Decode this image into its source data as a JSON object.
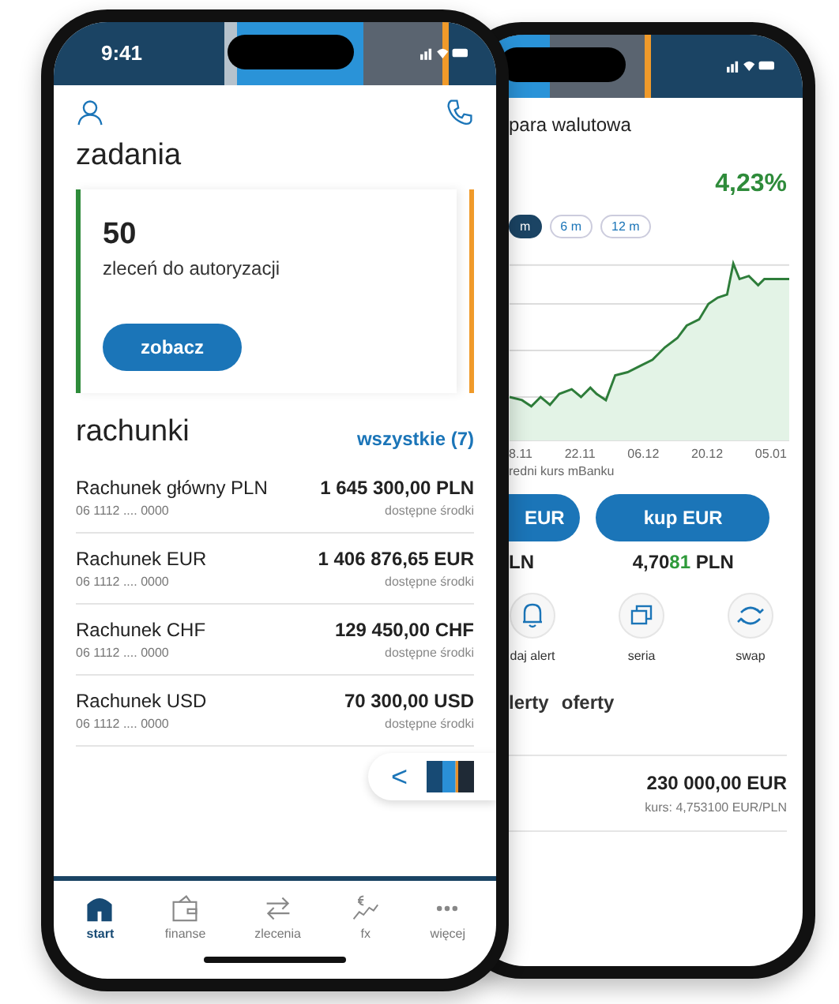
{
  "front_phone": {
    "status_time": "9:41",
    "tasks": {
      "title": "zadania",
      "count": "50",
      "label": "zleceń do autoryzacji",
      "button": "zobacz"
    },
    "accounts": {
      "title": "rachunki",
      "all_link": "wszystkie (7)",
      "rows": [
        {
          "name": "Rachunek główny PLN",
          "number": "06 1112 .... 0000",
          "amount": "1 645 300,00 PLN",
          "caption": "dostępne środki"
        },
        {
          "name": "Rachunek EUR",
          "number": "06 1112 .... 0000",
          "amount": "1 406 876,65 EUR",
          "caption": "dostępne środki"
        },
        {
          "name": "Rachunek CHF",
          "number": "06 1112 .... 0000",
          "amount": "129 450,00 CHF",
          "caption": "dostępne środki"
        },
        {
          "name": "Rachunek USD",
          "number": "06 1112 .... 0000",
          "amount": "70 300,00 USD",
          "caption": "dostępne środki"
        }
      ]
    },
    "pill_arrow": "<",
    "nav": [
      {
        "label": "start",
        "kind": "home",
        "selected": true
      },
      {
        "label": "finanse",
        "kind": "wallet",
        "selected": false
      },
      {
        "label": "zlecenia",
        "kind": "transfer",
        "selected": false
      },
      {
        "label": "fx",
        "kind": "fx",
        "selected": false
      },
      {
        "label": "więcej",
        "kind": "more",
        "selected": false
      }
    ]
  },
  "back_phone": {
    "title": "para walutowa",
    "change": "4,23%",
    "ranges": [
      {
        "label": "m",
        "selected": true
      },
      {
        "label": "6 m",
        "selected": false
      },
      {
        "label": "12 m",
        "selected": false
      }
    ],
    "x_labels": [
      "8.11",
      "22.11",
      "06.12",
      "20.12",
      "05.01"
    ],
    "chart_caption": "redni kurs mBanku",
    "sell": {
      "button": "EUR",
      "rate": "LN"
    },
    "buy": {
      "button": "kup EUR",
      "rate_lead": "4,70",
      "rate_change": "81",
      "rate_unit": " PLN"
    },
    "actions": [
      {
        "label": "daj alert",
        "kind": "bell"
      },
      {
        "label": "seria",
        "kind": "series"
      },
      {
        "label": "swap",
        "kind": "swap"
      }
    ],
    "tabs": [
      {
        "label": "lerty",
        "selected": false
      },
      {
        "label": "oferty",
        "selected": false
      }
    ],
    "offer": {
      "amount": "230 000,00 EUR",
      "rate": "kurs: 4,753100 EUR/PLN"
    }
  }
}
